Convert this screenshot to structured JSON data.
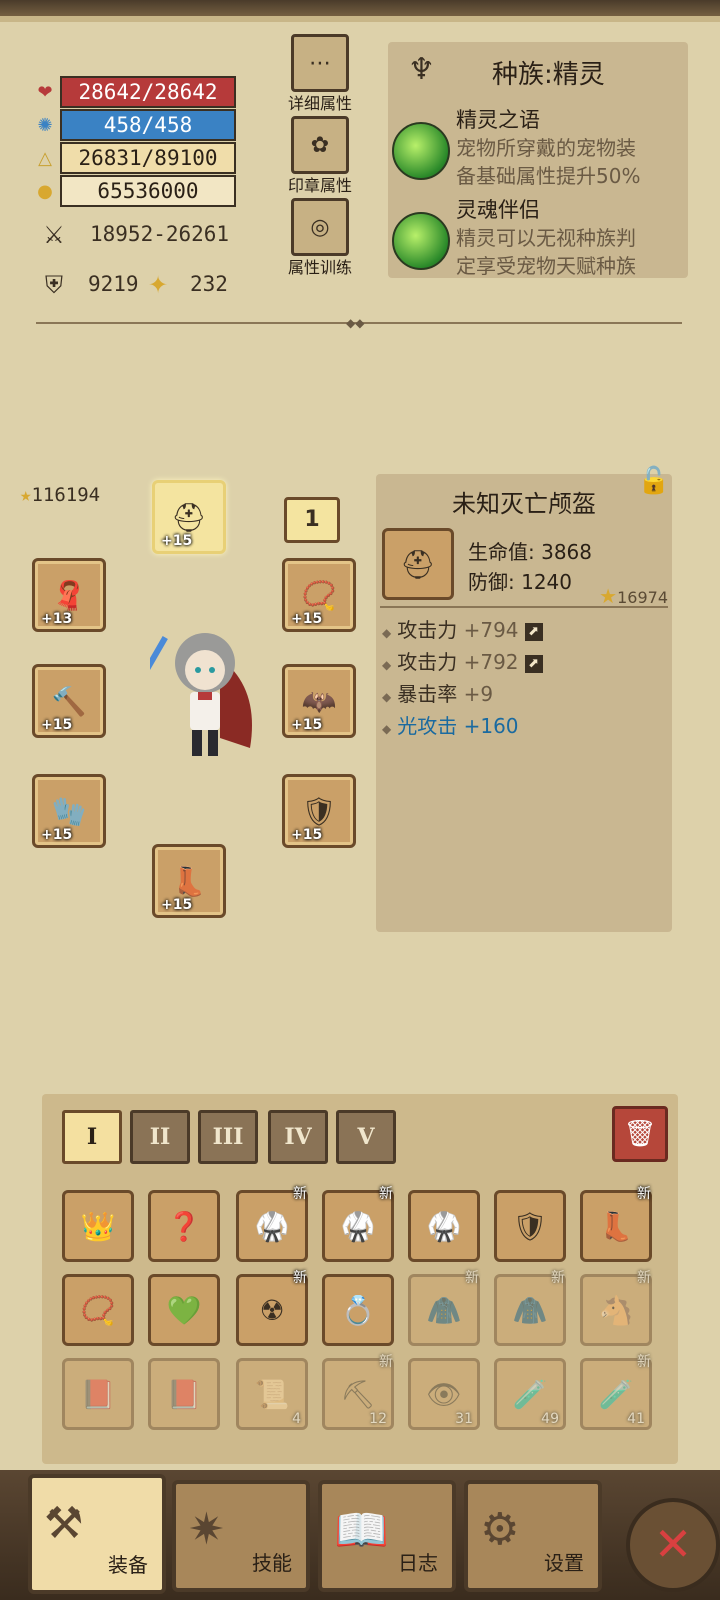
{
  "stats": {
    "hp": "28642/28642",
    "mp": "458/458",
    "exp": "26831/89100",
    "gold": "65536000",
    "attack": "18952-26261",
    "defense": "9219",
    "luck": "232"
  },
  "side_buttons": {
    "detail": "详细属性",
    "seal": "印章属性",
    "training": "属性训练"
  },
  "race": {
    "title": "种族:精灵",
    "skills": [
      {
        "name": "精灵之语",
        "desc1": "宠物所穿戴的宠物装",
        "desc2": "备基础属性提升50%"
      },
      {
        "name": "灵魂伴侣",
        "desc1": "精灵可以无视种族判",
        "desc2": "定享受宠物天赋种族"
      }
    ]
  },
  "equipment": {
    "power": "116194",
    "slot_number": "1",
    "slots": [
      {
        "plus": "+15"
      },
      {
        "plus": "+13"
      },
      {
        "plus": "+15"
      },
      {
        "plus": "+15"
      },
      {
        "plus": "+15"
      },
      {
        "plus": "+15"
      },
      {
        "plus": "+15"
      },
      {
        "plus": "+15"
      }
    ]
  },
  "detail": {
    "name": "未知灭亡颅盔",
    "hp_label": "生命值: 3868",
    "def_label": "防御: 1240",
    "score": "16974",
    "affixes": [
      {
        "label": "攻击力",
        "value": "+794"
      },
      {
        "label": "攻击力",
        "value": "+792"
      },
      {
        "label": "暴击率",
        "value": "+9"
      },
      {
        "label": "光攻击",
        "value": "+160"
      }
    ]
  },
  "inventory": {
    "tabs": [
      "I",
      "II",
      "III",
      "IV",
      "V"
    ],
    "new_label": "新",
    "counts": [
      "4",
      "12",
      "31",
      "49",
      "41"
    ]
  },
  "nav": {
    "equip": "装备",
    "skill": "技能",
    "log": "日志",
    "settings": "设置"
  },
  "colors": {
    "hp_bar": "#b63a3a",
    "mp_bar": "#3a82c4",
    "background": "#ddd1aa",
    "light_attack": "#1a6aa0"
  }
}
